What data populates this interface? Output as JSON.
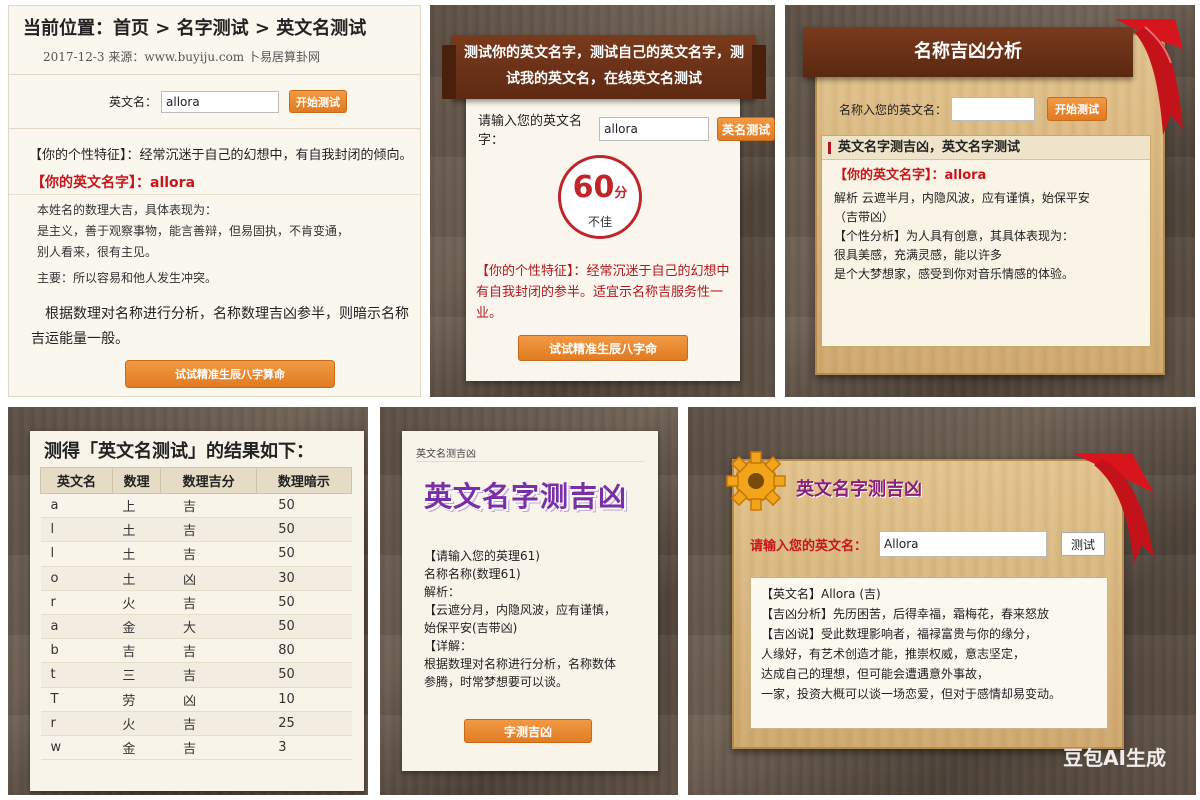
{
  "colors": {
    "accent_orange": "#e8842b",
    "red": "#c8161d",
    "banner_brown": "#6b3218",
    "purple": "#7a2ea8"
  },
  "panel1": {
    "breadcrumb": "当前位置：首页 > 名字测试 > 英文名测试",
    "meta": "2017-12-3 来源：www.buyiju.com 卜易居算卦网",
    "form_label": "英文名：",
    "input_value": "allora",
    "submit_label": "开始测试",
    "trait_line": "【你的个性特征】：经常沉迷于自己的幻想中，有自我封闭的倾向。",
    "your_name_label": "【你的英文名字】：",
    "your_name_value": "allora",
    "blurred_1": "本姓名的数理大吉，具体表现为：",
    "blurred_2": "是主义，善于观察事物，能言善辩，但易固执，不肯变通，",
    "blurred_3": "别人看来，很有主见。",
    "blurred_4": "主要：所以容易和他人发生冲突。",
    "analysis": "根据数理对名称进行分析，名称数理吉凶参半，则暗示名称吉运能量一般。",
    "big_button": "试试精准生辰八字算命"
  },
  "panel2": {
    "banner": "测试你的英文名字，测试自己的英文名字，测试我的英文名，在线英文名测试",
    "prompt": "请输入您的英文名字：",
    "input_value": "allora",
    "button": "英名测试",
    "score": "60",
    "score_unit": "分",
    "level": "不佳",
    "trait": "【你的个性特征】：经常沉迷于自己的幻想中有自我封闭的参半。适宜示名称吉服务性一业。",
    "big_button": "试试精准生辰八字命"
  },
  "panel3": {
    "banner": "名称吉凶分析",
    "prompt": "名称入您的英文名：",
    "button": "开始测试",
    "section_head": "英文名字测吉凶，英文名字测试",
    "your_name_label": "【你的英文名字】：",
    "your_name_value": "allora",
    "line1": "解析  云遮半月，内隐风波，应有谨慎，始保平安",
    "line2": "（吉带凶）",
    "line3": "【个性分析】为人具有创意，其具体表现为：",
    "line4": "很具美感，充满灵感，能以许多",
    "line5": "是个大梦想家，感受到你对音乐情感的体验。"
  },
  "panel4": {
    "title": "测得「英文名测试」的结果如下：",
    "headers": [
      "英文名",
      "数理",
      "数理吉分",
      "数理暗示"
    ],
    "rows": [
      [
        "a",
        "上",
        "吉",
        "50"
      ],
      [
        "l",
        "土",
        "吉",
        "50"
      ],
      [
        "l",
        "土",
        "吉",
        "50"
      ],
      [
        "o",
        "土",
        "凶",
        "30"
      ],
      [
        "r",
        "火",
        "吉",
        "50"
      ],
      [
        "a",
        "金",
        "大",
        "50"
      ],
      [
        "b",
        "吉",
        "吉",
        "80"
      ],
      [
        "t",
        "三",
        "吉",
        "50"
      ],
      [
        "T",
        "劳",
        "凶",
        "10"
      ],
      [
        "r",
        "火",
        "吉",
        "25"
      ],
      [
        "w",
        "金",
        "吉",
        "3"
      ]
    ]
  },
  "panel5": {
    "small_label": "英文名测吉凶",
    "title": "英文名字测吉凶",
    "l1": "【请输入您的英理61)",
    "l2": "名称名称(数理61)",
    "l3": "解析：",
    "l4": "【云遮分月，内隐风波，应有谨慎，",
    "l5": "始保平安(吉带凶)",
    "l6": "【详解：",
    "l7": "根据数理对名称进行分析，名称数体",
    "l8": "参腾，时常梦想要可以谈。",
    "button": "字测吉凶"
  },
  "panel6": {
    "title": "英文名字测吉凶",
    "label": "请输入您的英文名：",
    "input_value": "Allora",
    "button": "测试",
    "r1": "【英文名】Allora (吉)",
    "r2": "【吉凶分析】先历困苦，后得幸福，霜梅花，春来怒放",
    "r3": "【吉凶说】受此数理影响者，福禄富贵与你的缘分，",
    "r4": "人缘好，有艺术创造才能，推崇权威，意志坚定，",
    "r5": "达成自己的理想，但可能会遭遇意外事故，",
    "r6": "一家，投资大概可以谈一场恋爱，但对于感情却易变动。",
    "watermark": "豆包AI生成"
  }
}
